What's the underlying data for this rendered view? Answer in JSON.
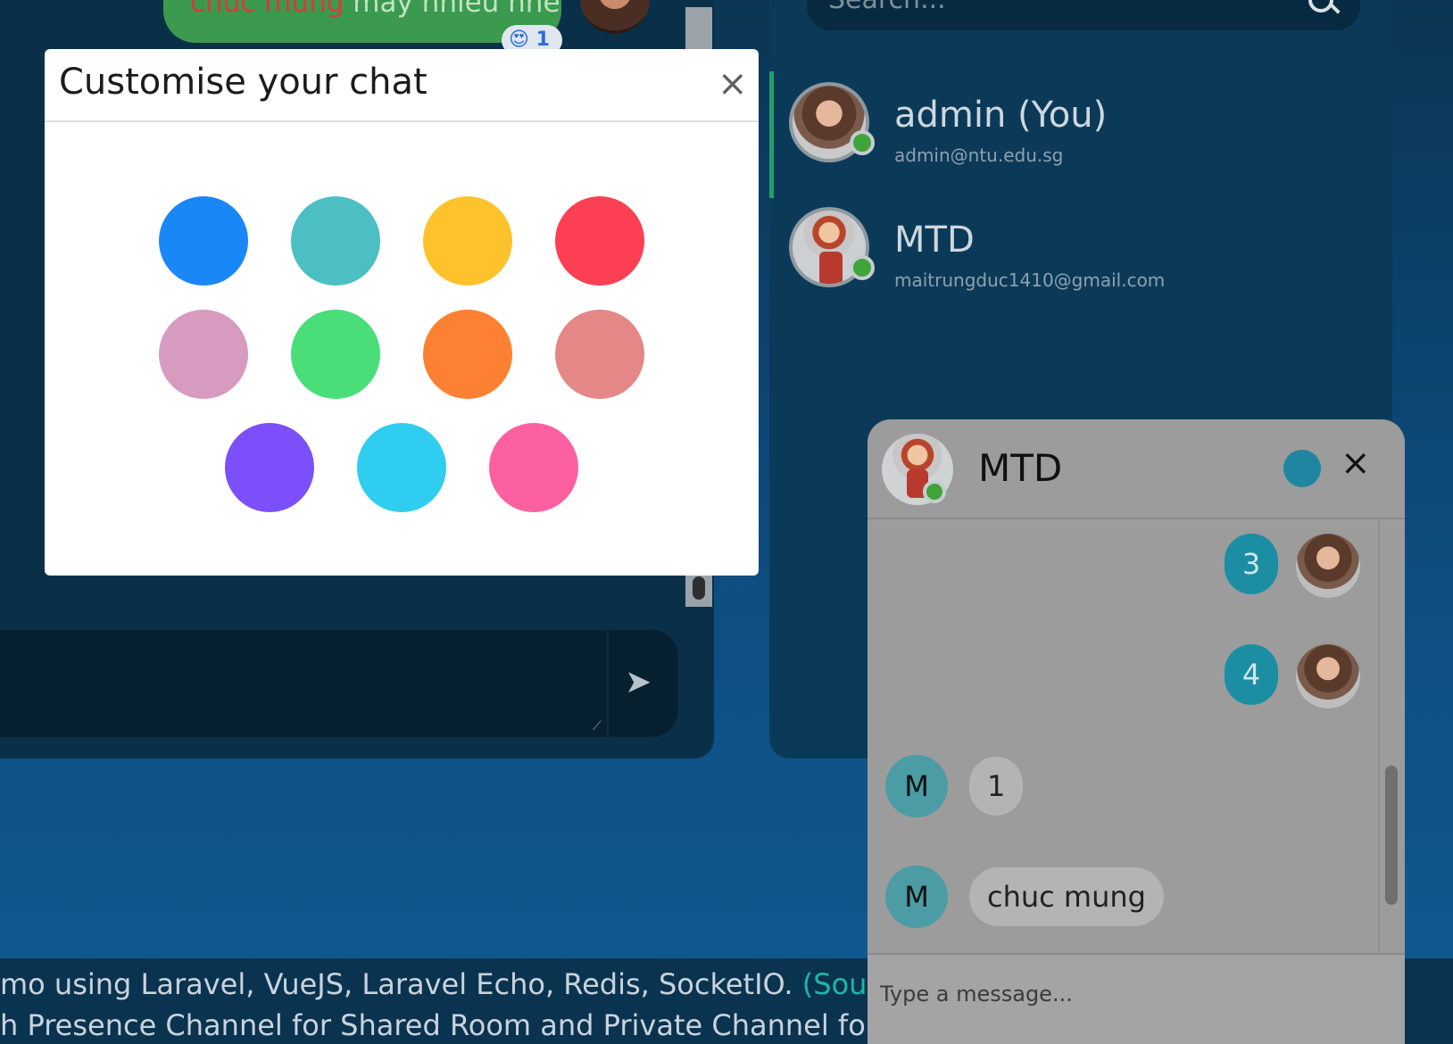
{
  "background_chat": {
    "message_highlight": "chuc mung",
    "message_rest": " may nhieu nhe",
    "reaction_emoji": "😍",
    "reaction_count": "1",
    "send_icon": "send-arrow-icon"
  },
  "users_panel": {
    "search_placeholder": "Search...",
    "users": [
      {
        "name": "admin (You)",
        "email": "admin@ntu.edu.sg",
        "status": "online"
      },
      {
        "name": "MTD",
        "email": "maitrungduc1410@gmail.com",
        "status": "online"
      }
    ]
  },
  "footer": {
    "line1_text": "mo using Laravel, VueJS, Laravel Echo, Redis, SocketIO. ",
    "line1_link": "(Source code",
    "line2_text": "h Presence Channel for Shared Room and Private Channel for private"
  },
  "chat_popup": {
    "title": "MTD",
    "theme_color": "#1e86a0",
    "close_label": "×",
    "messages": [
      {
        "from": "me",
        "text": "3"
      },
      {
        "from": "me",
        "text": "4"
      },
      {
        "from": "them",
        "initial": "M",
        "text": "1"
      },
      {
        "from": "them",
        "initial": "M",
        "text": "chuc mung"
      }
    ],
    "input_placeholder": "Type a message..."
  },
  "modal": {
    "title": "Customise your chat",
    "close_label": "×",
    "colors": [
      "#1a87f7",
      "#4bbfc4",
      "#fec22c",
      "#fd3f53",
      "#d79bbf",
      "#49de78",
      "#fe8133",
      "#e58787",
      "#7b4ff9",
      "#2fcdf0",
      "#fd60a1"
    ]
  }
}
